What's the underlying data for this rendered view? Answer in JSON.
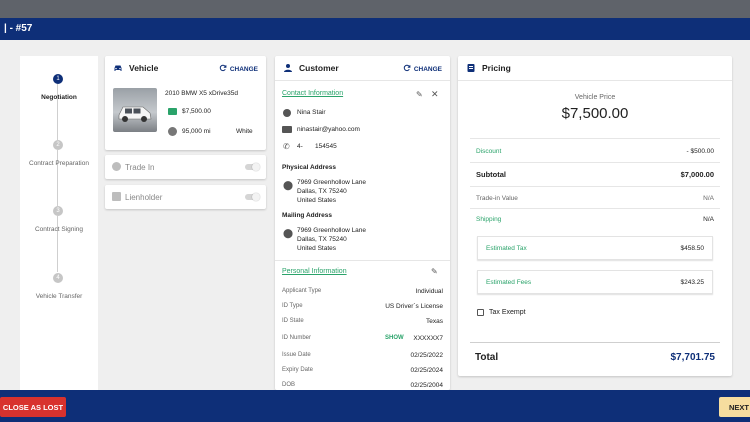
{
  "header": {
    "title": "| - #57"
  },
  "stepper": {
    "steps": [
      {
        "number": "1",
        "label": "Negotiation"
      },
      {
        "number": "2",
        "label": "Contract Preparation"
      },
      {
        "number": "3",
        "label": "Contract Signing"
      },
      {
        "number": "4",
        "label": "Vehicle Transfer"
      }
    ]
  },
  "vehicle": {
    "heading": "Vehicle",
    "change_label": "CHANGE",
    "name": "2010 BMW X5 xDrive35d",
    "price": "$7,500.00",
    "mileage": "95,000 mi",
    "color": "White",
    "trade_in_label": "Trade In",
    "lienholder_label": "Lienholder"
  },
  "customer": {
    "heading": "Customer",
    "change_label": "CHANGE",
    "contact_heading": "Contact Information",
    "name": "Nina Stair",
    "email": "ninastair@yahoo.com",
    "phone_prefix": "4-",
    "phone_suffix": "154545",
    "physical_address_label": "Physical Address",
    "physical_address": [
      "7969 Greenhollow Lane",
      "Dallas, TX 75240",
      "United States"
    ],
    "mailing_address_label": "Mailing Address",
    "mailing_address": [
      "7969 Greenhollow Lane",
      "Dallas, TX 75240",
      "United States"
    ],
    "personal_heading": "Personal Information",
    "personal": {
      "applicant_type_label": "Applicant Type",
      "applicant_type": "Individual",
      "id_type_label": "ID Type",
      "id_type": "US Driver`s License",
      "id_state_label": "ID State",
      "id_state": "Texas",
      "id_number_label": "ID Number",
      "show_label": "SHOW",
      "id_number": "XXXXXX7",
      "issue_date_label": "Issue Date",
      "issue_date": "02/25/2022",
      "expiry_date_label": "Expiry Date",
      "expiry_date": "02/25/2024",
      "dob_label": "DOB",
      "dob": "02/25/2004"
    }
  },
  "pricing": {
    "heading": "Pricing",
    "vehicle_price_label": "Vehicle Price",
    "vehicle_price": "$7,500.00",
    "discount_label": "Discount",
    "discount": "- $500.00",
    "subtotal_label": "Subtotal",
    "subtotal": "$7,000.00",
    "trade_in_label": "Trade-in Value",
    "trade_in": "N/A",
    "shipping_label": "Shipping",
    "shipping": "N/A",
    "tax_label": "Estimated Tax",
    "tax": "$458.50",
    "fees_label": "Estimated Fees",
    "fees": "$243.25",
    "tax_exempt_label": "Tax Exempt",
    "total_label": "Total",
    "total": "$7,701.75"
  },
  "footer": {
    "close_lost_label": "CLOSE AS LOST",
    "next_label": "NEXT"
  },
  "colors": {
    "brand": "#0e2f78",
    "accent_green": "#2aa36a",
    "danger": "#d8322e",
    "next_bg": "#f6dd9f"
  }
}
